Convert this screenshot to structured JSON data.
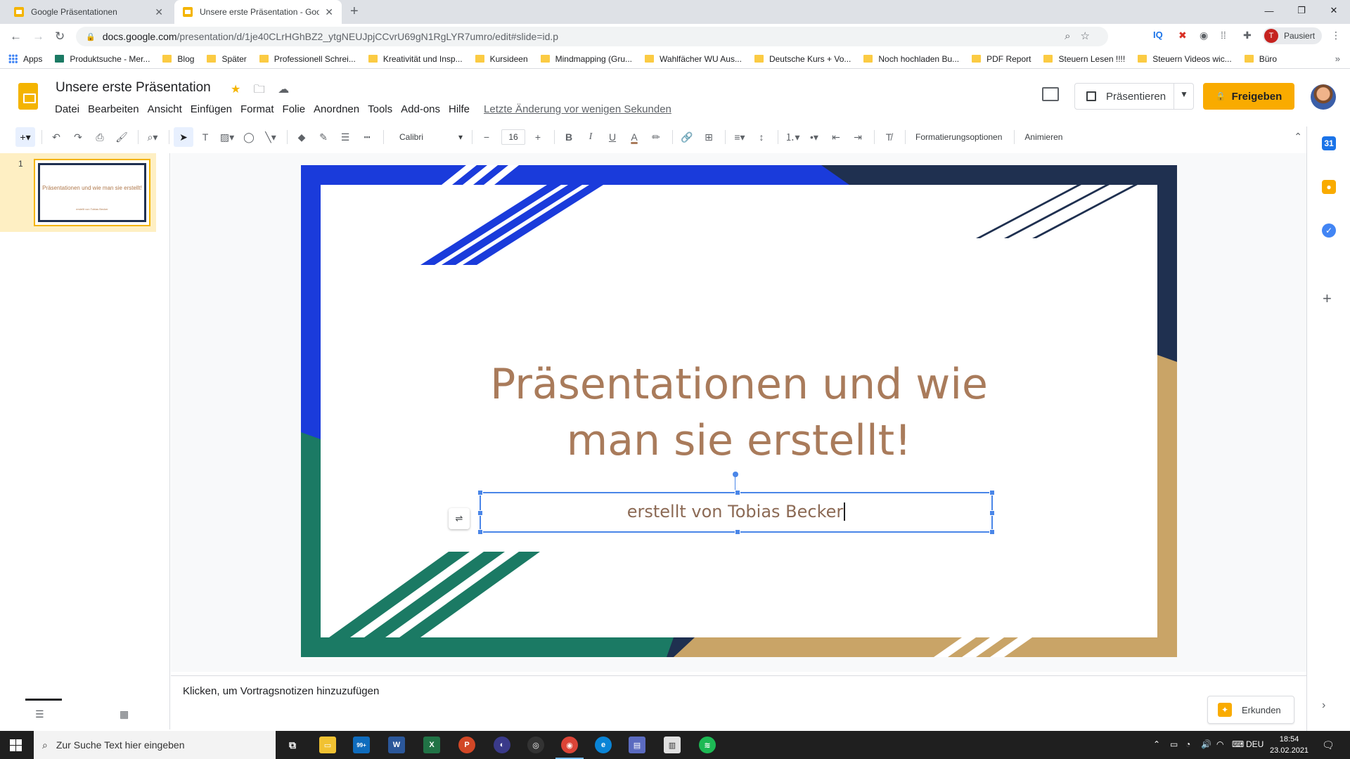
{
  "browser": {
    "tabs": [
      {
        "title": "Google Präsentationen"
      },
      {
        "title": "Unsere erste Präsentation - Goo"
      }
    ],
    "url_host": "docs.google.com",
    "url_path": "/presentation/d/1je40CLrHGhBZ2_ytgNEUJpjCCvrU69gN1RgLYR7umro/edit#slide=id.p",
    "profile_initial": "T",
    "profile_status": "Pausiert",
    "bookmarks": [
      "Apps",
      "Produktsuche - Mer...",
      "Blog",
      "Später",
      "Professionell Schrei...",
      "Kreativität und Insp...",
      "Kursideen",
      "Mindmapping (Gru...",
      "Wahlfächer WU Aus...",
      "Deutsche Kurs + Vo...",
      "Noch hochladen Bu...",
      "PDF Report",
      "Steuern Lesen !!!!",
      "Steuern Videos wic...",
      "Büro"
    ]
  },
  "app": {
    "doc_title": "Unsere erste Präsentation",
    "menu": [
      "Datei",
      "Bearbeiten",
      "Ansicht",
      "Einfügen",
      "Format",
      "Folie",
      "Anordnen",
      "Tools",
      "Add-ons",
      "Hilfe"
    ],
    "last_edit": "Letzte Änderung vor wenigen Sekunden",
    "present_label": "Präsentieren",
    "share_label": "Freigeben",
    "accent": "#f4b400"
  },
  "toolbar": {
    "font": "Calibri",
    "font_size": "16",
    "format_options": "Formatierungsoptionen",
    "animate": "Animieren"
  },
  "filmstrip": {
    "slide_number": "1",
    "thumb_title": "Präsentationen und wie man sie erstellt!",
    "thumb_sub": "erstellt von Tobias Becker"
  },
  "slide": {
    "title_line1": "Präsentationen und wie",
    "title_line2": "man sie erstellt!",
    "subtitle": "erstellt von Tobias Becker",
    "colors": {
      "blue": "#1a3bdb",
      "dark": "#1f3050",
      "green": "#1b7a64",
      "gold": "#c9a467",
      "title_text": "#a97b5b"
    }
  },
  "notes": {
    "placeholder": "Klicken, um Vortragsnotizen hinzuzufügen",
    "explore_label": "Erkunden"
  },
  "taskbar": {
    "search_placeholder": "Zur Suche Text hier eingeben",
    "mail_badge": "99+",
    "language": "DEU",
    "time": "18:54",
    "date": "23.02.2021"
  }
}
